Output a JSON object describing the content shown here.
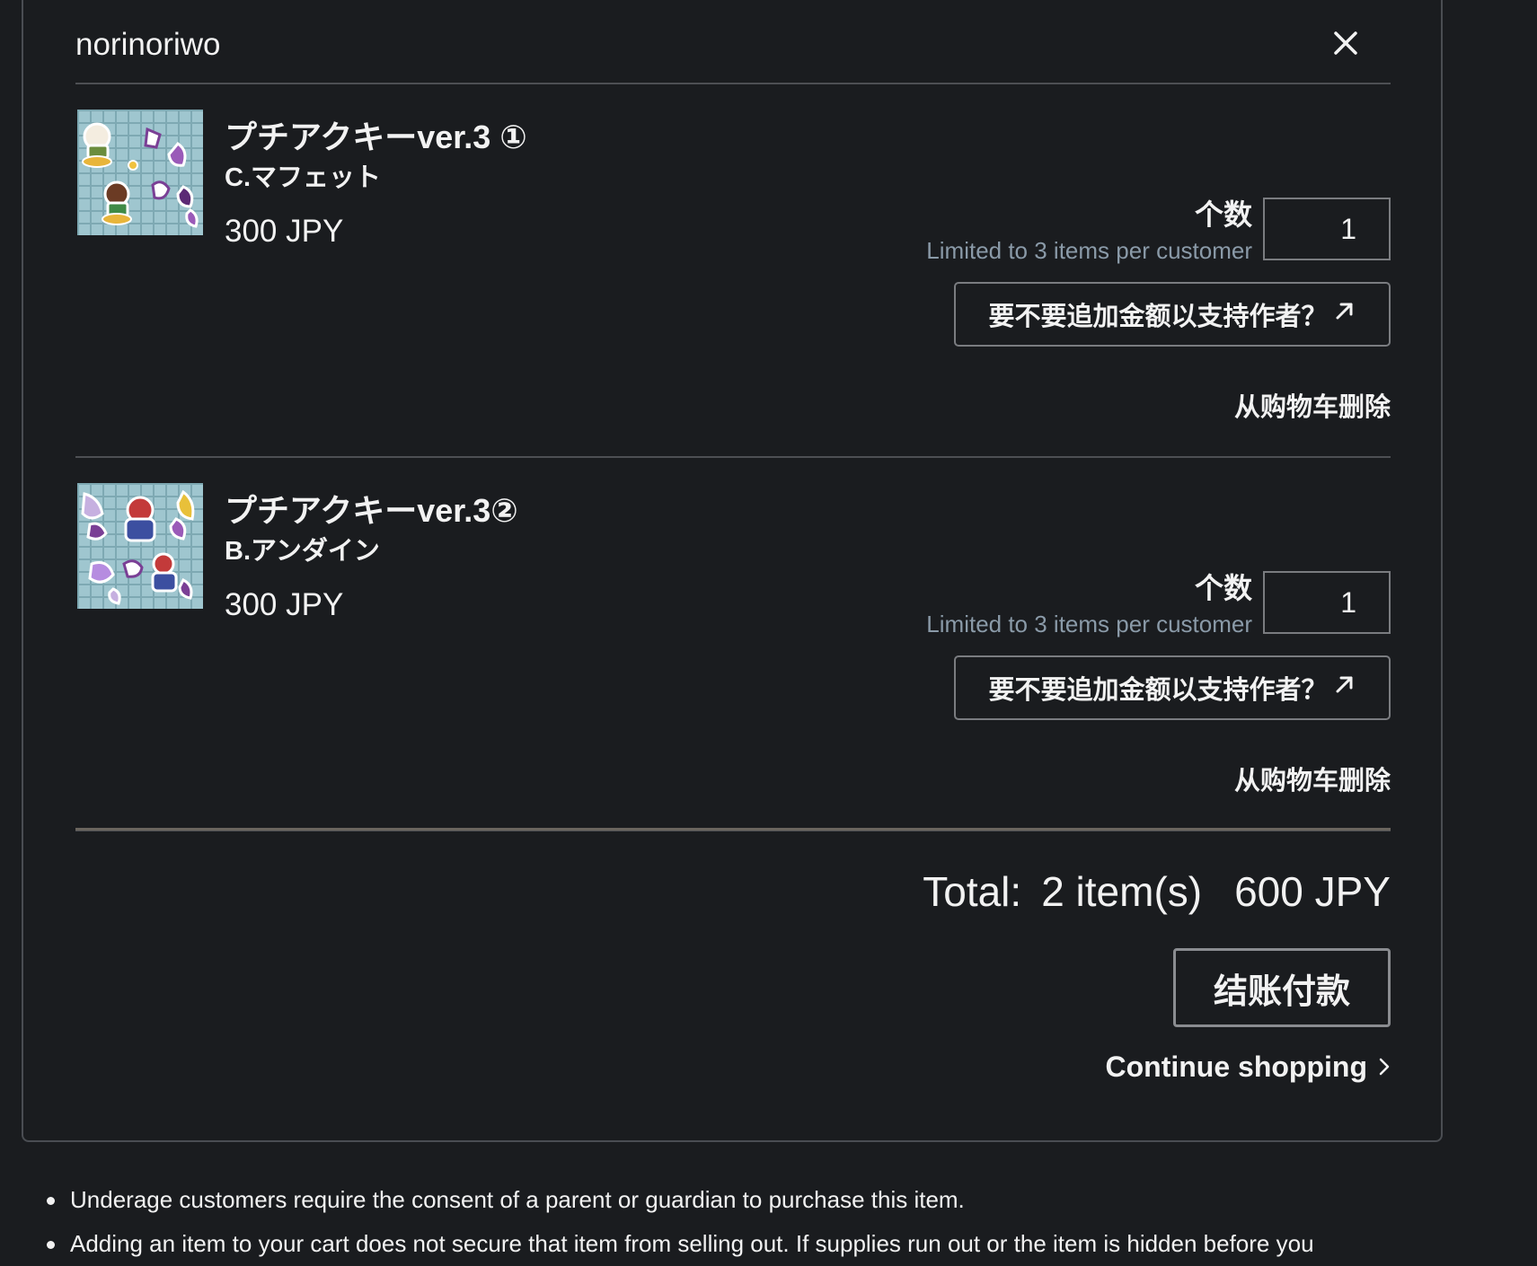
{
  "shop": {
    "name": "norinoriwo",
    "close_icon": "close-icon"
  },
  "items": [
    {
      "title": "プチアクキーver.3 ①",
      "variant": "C.マフェット",
      "price": "300 JPY",
      "qty_label": "个数",
      "qty_limit": "Limited to 3 items per customer",
      "qty_value": "1",
      "support_label": "要不要追加金额以支持作者？",
      "support_icon": "external-link-icon",
      "remove_label": "从购物车删除"
    },
    {
      "title": "プチアクキーver.3②",
      "variant": "B.アンダイン",
      "price": "300 JPY",
      "qty_label": "个数",
      "qty_limit": "Limited to 3 items per customer",
      "qty_value": "1",
      "support_label": "要不要追加金额以支持作者？",
      "support_icon": "external-link-icon",
      "remove_label": "从购物车删除"
    }
  ],
  "summary": {
    "total_label": "Total:",
    "item_count": "2 item(s)",
    "total_price": "600 JPY",
    "checkout_label": "结账付款",
    "continue_label": "Continue shopping",
    "continue_icon": "chevron-right-icon"
  },
  "notes": [
    "Underage customers require the consent of a parent or guardian to purchase this item.",
    "Adding an item to your cart does not secure that item from selling out. If supplies run out or the item is hidden before you"
  ]
}
